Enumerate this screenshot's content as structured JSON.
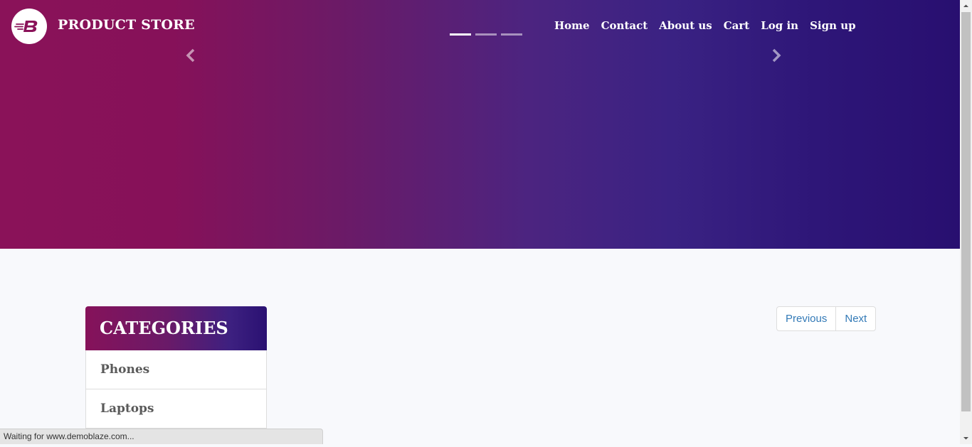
{
  "header": {
    "brand": "PRODUCT STORE",
    "logo_icon": "blazemeter-b-icon",
    "nav": [
      {
        "label": "Home"
      },
      {
        "label": "Contact"
      },
      {
        "label": "About us"
      },
      {
        "label": "Cart"
      },
      {
        "label": "Log in"
      },
      {
        "label": "Sign up"
      }
    ]
  },
  "carousel": {
    "slide_count": 3,
    "active_slide": 1,
    "prev_icon": "chevron-left-icon",
    "next_icon": "chevron-right-icon"
  },
  "categories": {
    "title": "CATEGORIES",
    "items": [
      {
        "label": "Phones"
      },
      {
        "label": "Laptops"
      }
    ]
  },
  "pagination": {
    "previous_label": "Previous",
    "next_label": "Next"
  },
  "status_bar": {
    "text": "Waiting for www.demoblaze.com..."
  },
  "colors": {
    "brand_magenta": "#8a1259",
    "brand_purple": "#280f70",
    "link_blue": "#337ab7"
  }
}
